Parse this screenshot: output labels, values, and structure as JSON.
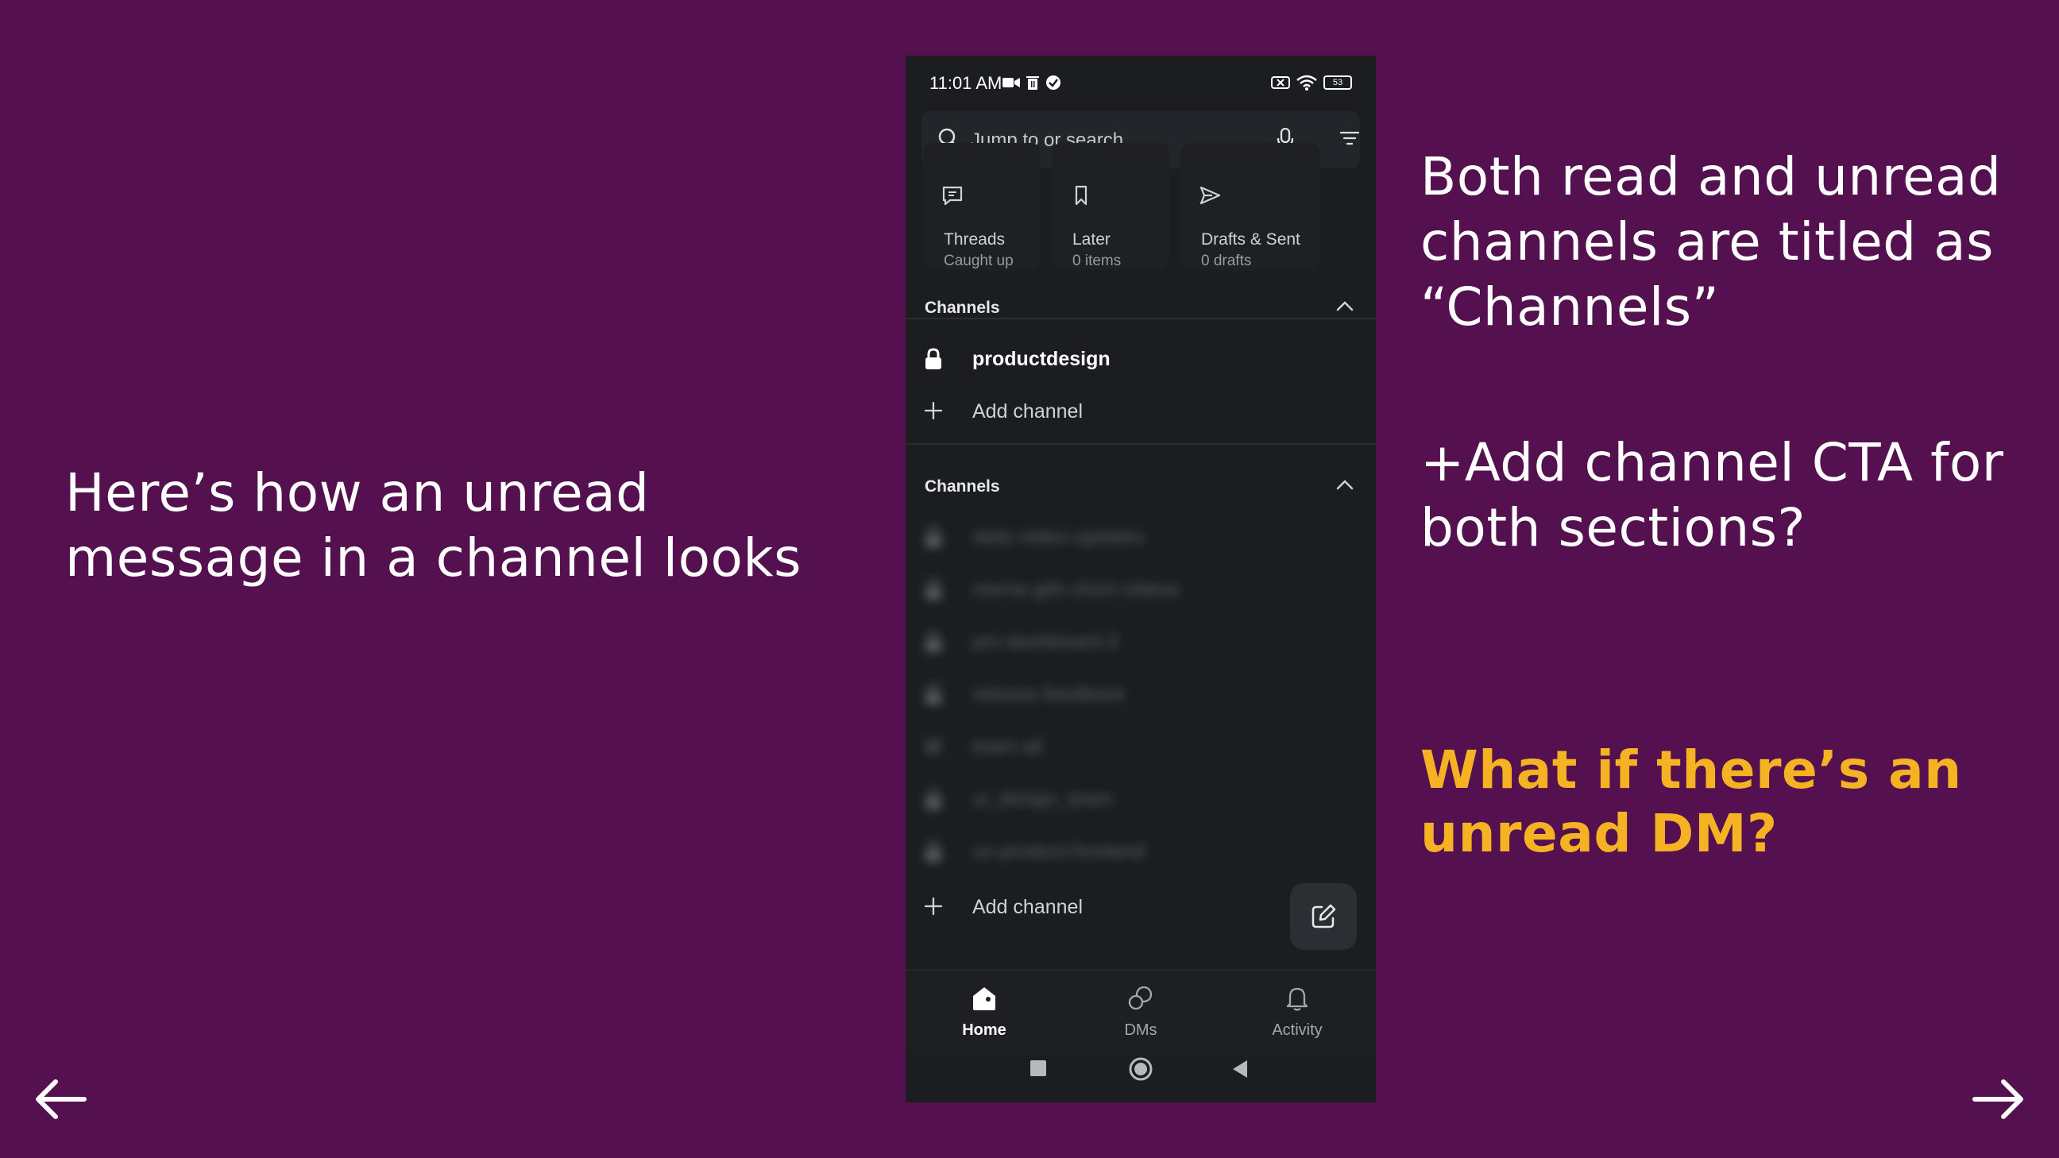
{
  "slide": {
    "left_caption": "Here’s how an unread message in a channel looks",
    "right_note_1": "Both read and unread channels are titled as “Channels”",
    "right_note_2": "+Add channel CTA for both sections?",
    "right_question": "What if there’s an unread DM?",
    "accent_color": "#f5b323",
    "background_color": "#54104f"
  },
  "phone": {
    "status": {
      "time": "11:01 AM",
      "battery": "53"
    },
    "search": {
      "placeholder": "Jump to or search..."
    },
    "quick_cards": [
      {
        "title": "Threads",
        "subtitle": "Caught up",
        "icon": "threads-icon"
      },
      {
        "title": "Later",
        "subtitle": "0 items",
        "icon": "bookmark-icon"
      },
      {
        "title": "Drafts & Sent",
        "subtitle": "0 drafts",
        "icon": "send-icon"
      }
    ],
    "section_1": {
      "title": "Channels",
      "channel": "productdesign",
      "add_label": "Add channel"
    },
    "section_2": {
      "title": "Channels",
      "add_label": "Add channel",
      "blurred_channels": [
        "daily-video-updates",
        "meme-gifs-short-videos",
        "pm-dashboard-3",
        "release-feedback",
        "team-all",
        "ui_design_team",
        "ux-product-frontend"
      ]
    },
    "tabs": [
      {
        "label": "Home",
        "icon": "home-icon",
        "active": true
      },
      {
        "label": "DMs",
        "icon": "dms-icon",
        "active": false
      },
      {
        "label": "Activity",
        "icon": "bell-icon",
        "active": false
      }
    ],
    "colors": {
      "background": "#1b1d21",
      "surface": "#222529"
    }
  }
}
